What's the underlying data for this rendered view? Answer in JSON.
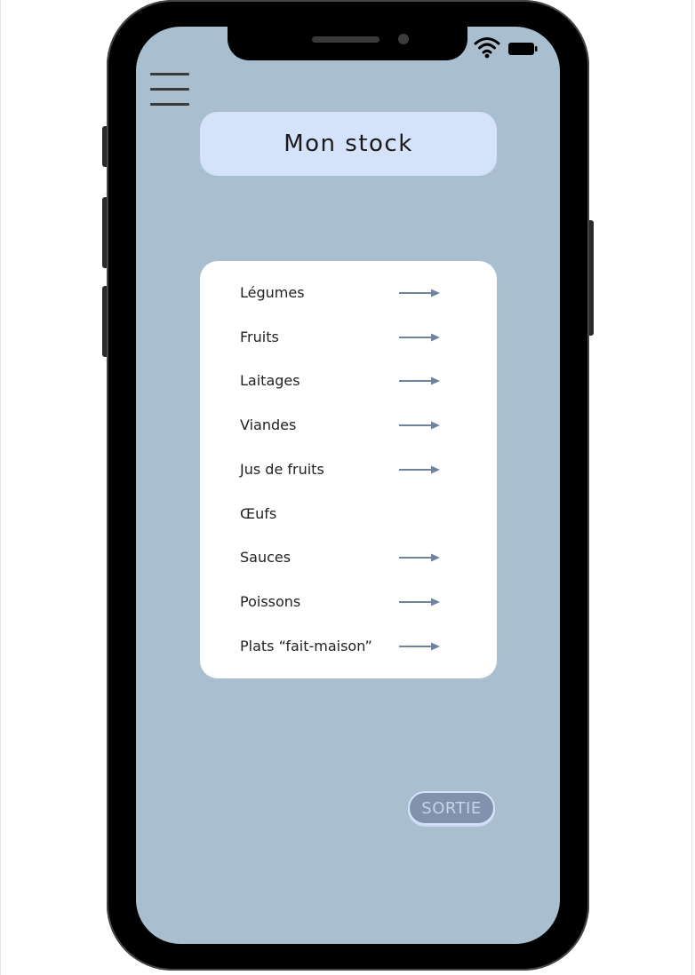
{
  "header": {
    "title": "Mon stock"
  },
  "menu": {
    "icon": "hamburger-menu-icon"
  },
  "status_bar": {
    "icons": [
      "wifi-icon",
      "battery-icon"
    ]
  },
  "categories": [
    {
      "label": "Légumes",
      "has_arrow": true
    },
    {
      "label": "Fruits",
      "has_arrow": true
    },
    {
      "label": "Laitages",
      "has_arrow": true
    },
    {
      "label": "Viandes",
      "has_arrow": true
    },
    {
      "label": "Jus de fruits",
      "has_arrow": true
    },
    {
      "label": "Œufs",
      "has_arrow": false
    },
    {
      "label": "Sauces",
      "has_arrow": true
    },
    {
      "label": "Poissons",
      "has_arrow": true
    },
    {
      "label": "Plats “fait-maison”",
      "has_arrow": true
    }
  ],
  "footer": {
    "exit_label": "SORTIE"
  },
  "colors": {
    "screen_background": "#a9bfcf",
    "title_background": "#d5e3fa",
    "card_background": "#ffffff",
    "arrow": "#6f829e",
    "exit_button": "#8092ac"
  }
}
